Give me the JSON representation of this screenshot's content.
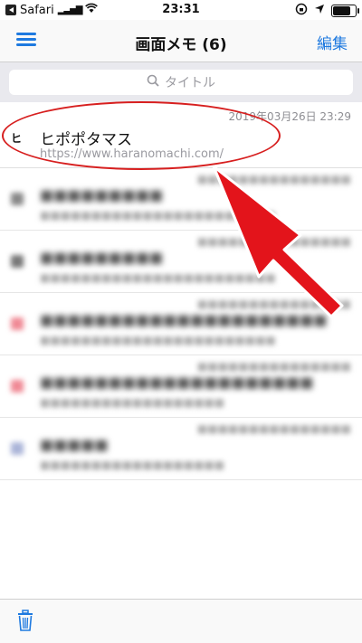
{
  "status": {
    "carrier": "Safari",
    "time": "23:31",
    "battery_level": 0.85
  },
  "nav": {
    "title": "画面メモ (6)",
    "edit_label": "編集",
    "menu_icon": "hamburger-menu-icon"
  },
  "search": {
    "placeholder": "タイトル",
    "icon": "search-icon"
  },
  "items": [
    {
      "date": "2019年03月26日 23:29",
      "title": "ヒポポタマス",
      "url": "https://www.haranomachi.com/",
      "favicon": "ヒ"
    }
  ],
  "blurred_items": [
    {
      "title": "■■■■■■■■■",
      "url": "■■■■■■■■■■■■■■■■■■■■■■■",
      "date": "■■■■■■■■■■■■■■■",
      "color": "#888888"
    },
    {
      "title": "■■■■■■■■■",
      "url": "■■■■■■■■■■■■■■■■■■■■■■■",
      "date": "■■■■■■■■■■■■■■■",
      "color": "#777777"
    },
    {
      "title": "■■■■■■■■■■■■■■■■■■■■■",
      "url": "■■■■■■■■■■■■■■■■■■■■■■■",
      "date": "■■■■■■■■■■■■■■■",
      "color": "#f08a95"
    },
    {
      "title": "■■■■■■■■■■■■■■■■■■■■",
      "url": "■■■■■■■■■■■■■■■■■■",
      "date": "■■■■■■■■■■■■■■■",
      "color": "#f08a95"
    },
    {
      "title": "■■■■■",
      "url": "■■■■■■■■■■■■■■■■■■",
      "date": "■■■■■■■■■■■■■■■",
      "color": "#aab4d8"
    }
  ],
  "toolbar": {
    "trash_icon": "trash-icon"
  },
  "colors": {
    "accent": "#1f7ae0",
    "annotation": "#d71f1f"
  }
}
